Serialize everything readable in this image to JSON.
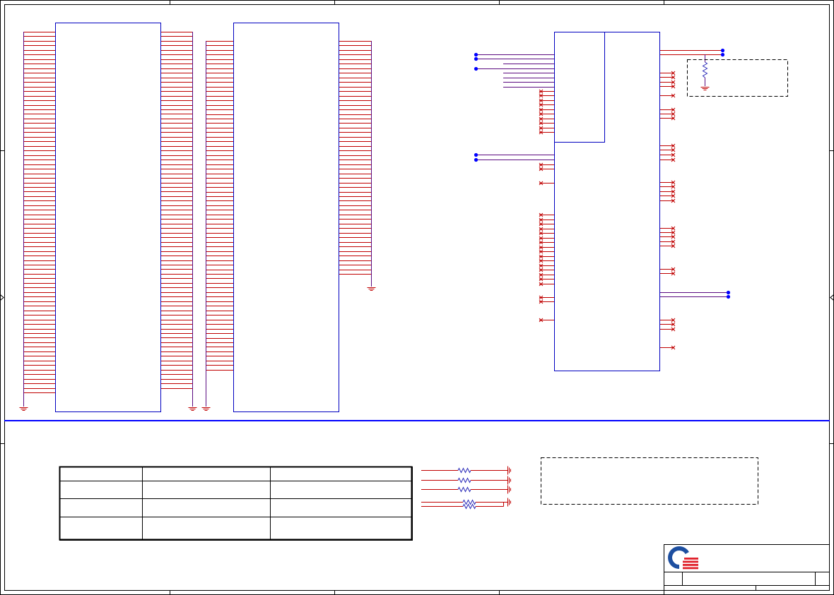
{
  "colors": {
    "wire": "#c00000",
    "net_wire": "#5a0a80",
    "component_outline": "#0000c0",
    "junction_dot": "#0000ff",
    "sheet_divider": "#0000ff",
    "frame": "#000000",
    "resistor": "#2a2ab8",
    "logo_blue": "#1d4fa0",
    "logo_red": "#e0202a"
  },
  "icons": {
    "logo": "company-logo-icon",
    "ground": "ground-icon",
    "no_connect": "no-connect-icon",
    "resistor": "resistor-icon",
    "junction": "junction-dot-icon",
    "zone_arrow": "zone-arrow-icon"
  }
}
